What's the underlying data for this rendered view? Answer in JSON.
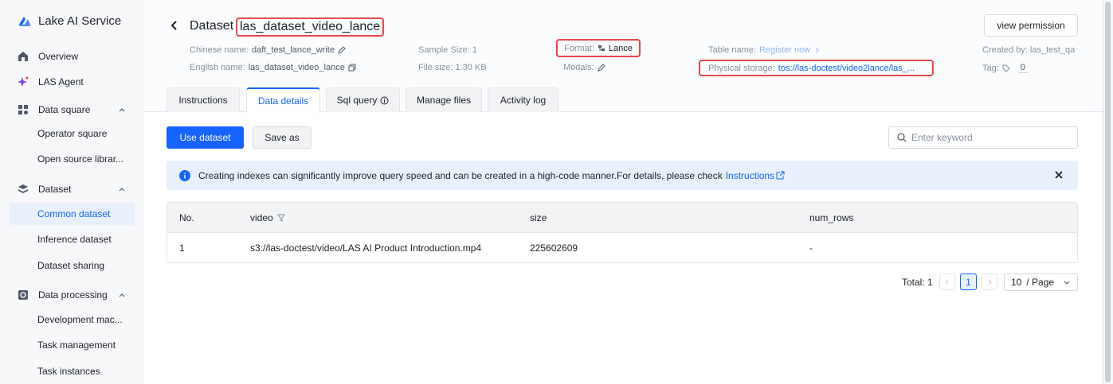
{
  "app": {
    "name": "Lake AI Service"
  },
  "sidebar": {
    "items": [
      {
        "label": "Overview",
        "type": "top"
      },
      {
        "label": "LAS Agent",
        "type": "top"
      },
      {
        "label": "Data square",
        "type": "group"
      },
      {
        "label": "Operator square",
        "type": "sub"
      },
      {
        "label": "Open source librar...",
        "type": "sub"
      },
      {
        "label": "Dataset",
        "type": "group"
      },
      {
        "label": "Common dataset",
        "type": "sub",
        "active": true
      },
      {
        "label": "Inference dataset",
        "type": "sub"
      },
      {
        "label": "Dataset sharing",
        "type": "sub"
      },
      {
        "label": "Data processing",
        "type": "group"
      },
      {
        "label": "Development mac...",
        "type": "sub"
      },
      {
        "label": "Task management",
        "type": "sub"
      },
      {
        "label": "Task instances",
        "type": "sub"
      }
    ]
  },
  "header": {
    "title_prefix": "Dataset",
    "title_name": "las_dataset_video_lance",
    "view_permission": "view permission",
    "chinese_name_label": "Chinese name:",
    "chinese_name_value": "daft_test_lance_write",
    "english_name_label": "English name:",
    "english_name_value": "las_dataset_video_lance",
    "sample_size": "Sample Size: 1",
    "file_size": "File size: 1.30 KB",
    "format_label": "Format:",
    "format_value": "Lance",
    "modals_label": "Modals:",
    "table_name_label": "Table name:",
    "table_name_link": "Register now",
    "physical_storage_label": "Physical storage:",
    "physical_storage_value": "tos://las-doctest/video2lance/las_...",
    "created_by": "Created by: las_test_qa",
    "tag_label": "Tag:",
    "tag_value": "0"
  },
  "tabs": [
    {
      "label": "Instructions"
    },
    {
      "label": "Data details",
      "active": true
    },
    {
      "label": "Sql query"
    },
    {
      "label": "Manage files"
    },
    {
      "label": "Activity log"
    }
  ],
  "toolbar": {
    "use_dataset": "Use dataset",
    "save_as": "Save as",
    "search_placeholder": "Enter keyword"
  },
  "notice": {
    "text": "Creating indexes can significantly improve query speed and can be created in a high-code manner.For details, please check",
    "link": "Instructions"
  },
  "table": {
    "columns": [
      "No.",
      "video",
      "size",
      "num_rows"
    ],
    "rows": [
      [
        "1",
        "s3://las-doctest/video/LAS AI Product Introduction.mp4",
        "225602609",
        "-"
      ]
    ]
  },
  "pagination": {
    "total": "Total: 1",
    "current_page": "1",
    "page_size": "10",
    "page_size_suffix": "/ Page"
  },
  "colors": {
    "accent": "#1664ff",
    "highlight_border": "#e5484d",
    "notice_bg": "#e8f0fd"
  }
}
